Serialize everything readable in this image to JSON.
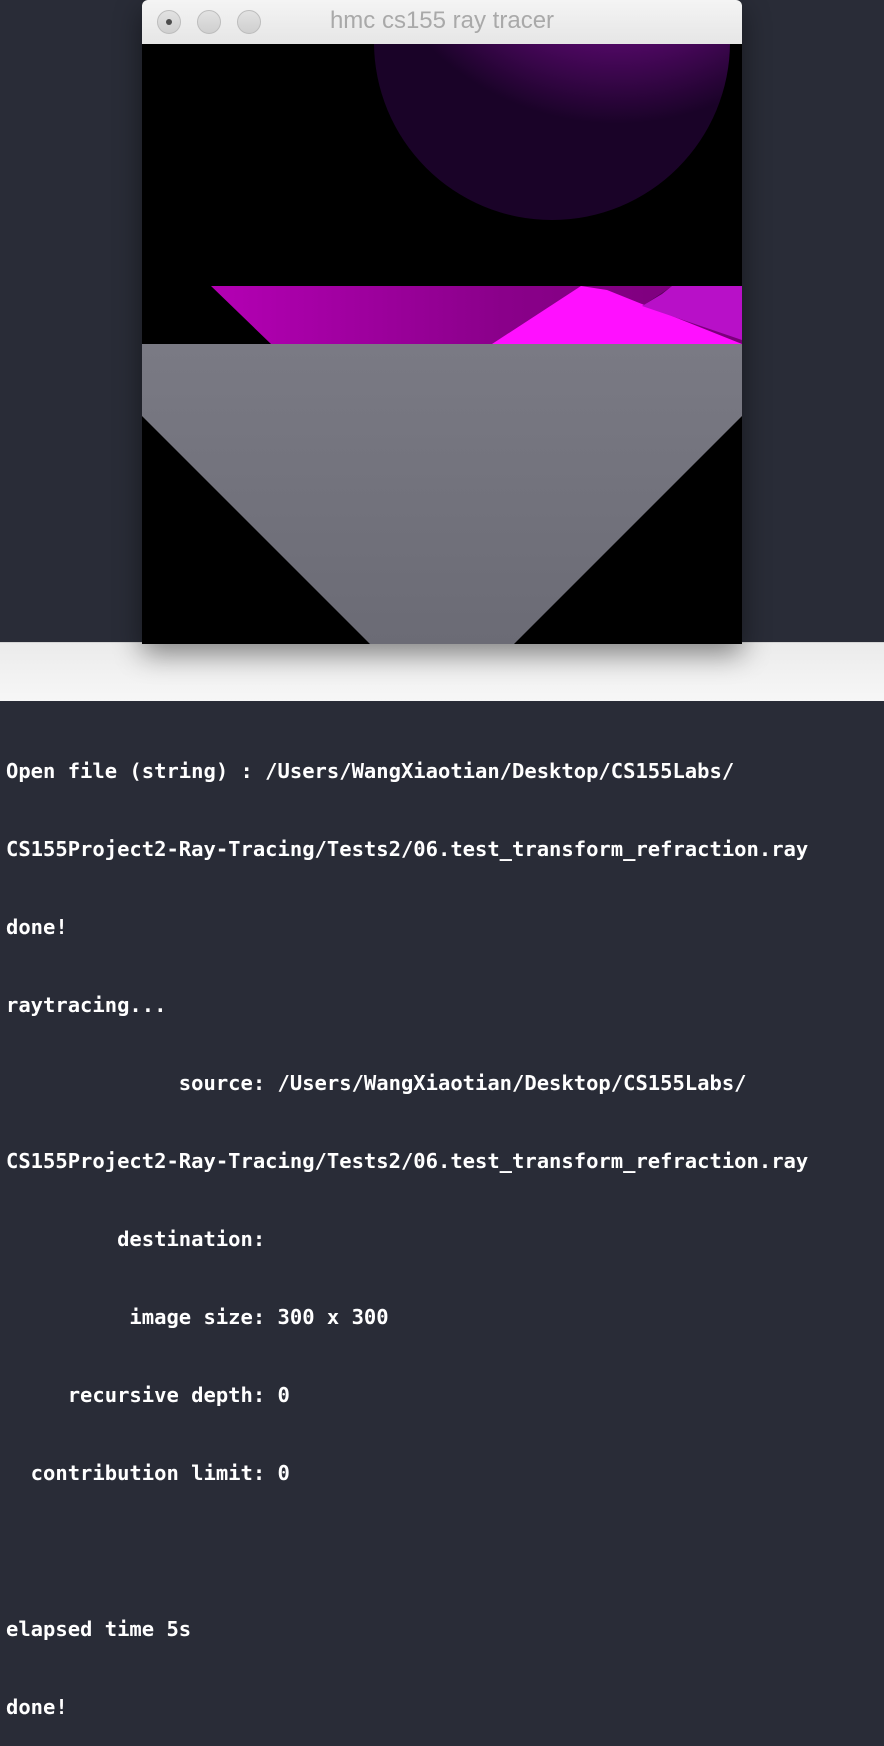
{
  "window": {
    "title": "hmc cs155 ray tracer"
  },
  "render": {
    "colors": {
      "background": "#000000",
      "floor": "#75757f",
      "sphere": "#7a0c94",
      "magenta_bright": "#ff0dff",
      "magenta_dark": "#9a009a"
    }
  },
  "console": {
    "lines": [
      "Open file (string) : /Users/WangXiaotian/Desktop/CS155Labs/",
      "CS155Project2-Ray-Tracing/Tests2/06.test_transform_refraction.ray",
      "done!",
      "raytracing...",
      "              source: /Users/WangXiaotian/Desktop/CS155Labs/",
      "CS155Project2-Ray-Tracing/Tests2/06.test_transform_refraction.ray",
      "         destination:",
      "          image size: 300 x 300",
      "     recursive depth: 0",
      "  contribution limit: 0",
      "",
      "elapsed time 5s",
      "done!"
    ]
  }
}
